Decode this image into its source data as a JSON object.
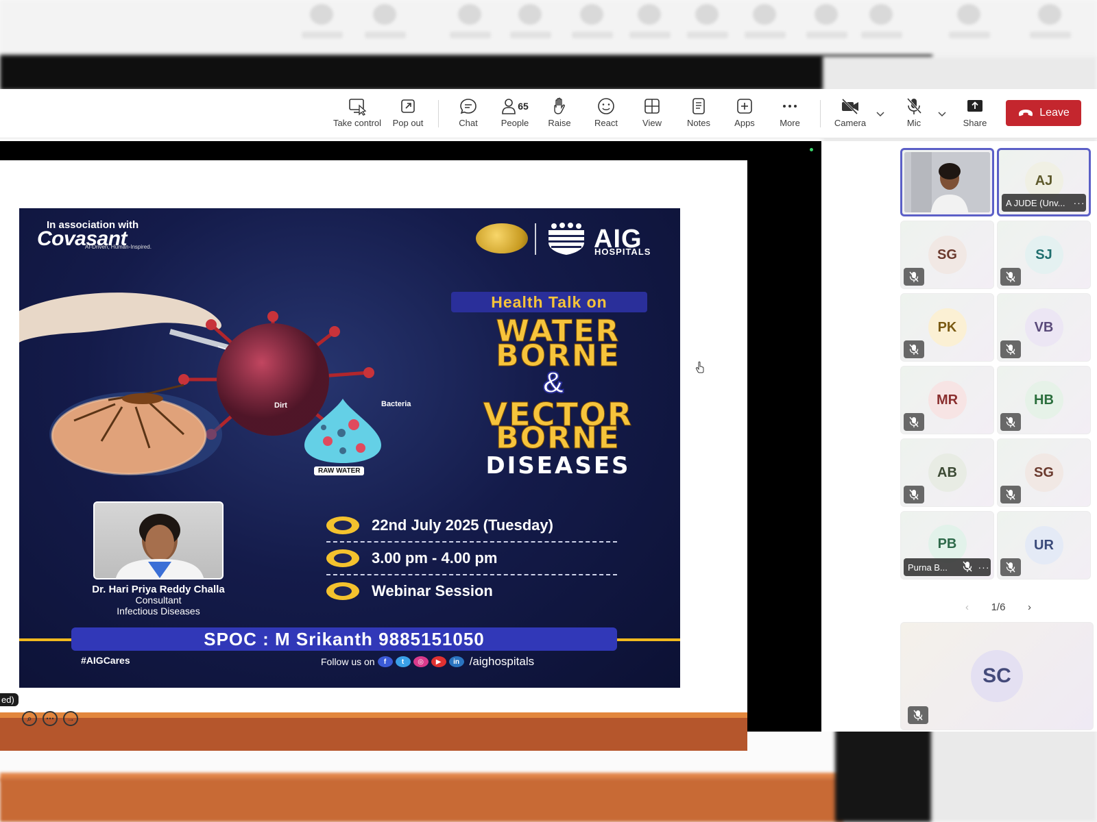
{
  "toolbar": {
    "take_control": "Take control",
    "pop_out": "Pop out",
    "chat": "Chat",
    "people": "People",
    "people_count": "65",
    "raise": "Raise",
    "react": "React",
    "view": "View",
    "notes": "Notes",
    "apps": "Apps",
    "more": "More",
    "camera": "Camera",
    "mic": "Mic",
    "share": "Share",
    "leave": "Leave",
    "leave_color": "#c4262e"
  },
  "stage": {
    "control_tag": "ed)",
    "poster": {
      "association": "In association with",
      "partner": "Covasant",
      "partner_tagline": "AI-Driven, Human-Inspired.",
      "brand": "AIG",
      "brand_sub": "HOSPITALS",
      "headline_tag": "Health Talk on",
      "line1": "WATER",
      "line2": "BORNE",
      "amp": "&",
      "line3": "VECTOR",
      "line4": "BORNE",
      "line5": "DISEASES",
      "dirt_label": "Dirt",
      "bacteria_label": "Bacteria",
      "raw_water_label": "RAW WATER",
      "doctor_name": "Dr. Hari Priya Reddy Challa",
      "doctor_role": "Consultant",
      "doctor_dept": "Infectious Diseases",
      "date": "22nd July 2025 (Tuesday)",
      "time": "3.00 pm - 4.00 pm",
      "venue": "Webinar Session",
      "spoc": "SPOC : M Srikanth 9885151050",
      "hashtag_prefix": "#AIG",
      "hashtag_suffix": "Cares",
      "follow_text": "Follow us on",
      "follow_handle": "/aighospitals",
      "accent_yellow": "#f6c43c",
      "accent_blue": "#3138b8"
    }
  },
  "gallery": {
    "tiles": [
      {
        "initials": "",
        "label": "",
        "type": "self-video"
      },
      {
        "initials": "AJ",
        "label": "A JUDE (Unv...",
        "type": "named"
      },
      {
        "initials": "SG",
        "label": "",
        "type": "muted"
      },
      {
        "initials": "SJ",
        "label": "",
        "type": "muted"
      },
      {
        "initials": "PK",
        "label": "",
        "type": "muted"
      },
      {
        "initials": "VB",
        "label": "",
        "type": "muted"
      },
      {
        "initials": "MR",
        "label": "",
        "type": "muted"
      },
      {
        "initials": "HB",
        "label": "",
        "type": "muted"
      },
      {
        "initials": "AB",
        "label": "",
        "type": "muted"
      },
      {
        "initials": "SG",
        "label": "",
        "type": "muted"
      },
      {
        "initials": "PB",
        "label": "Purna B...",
        "type": "named-muted"
      },
      {
        "initials": "UR",
        "label": "",
        "type": "muted"
      }
    ],
    "pager": "1/6",
    "featured_initials": "SC",
    "more_glyph": "···"
  }
}
